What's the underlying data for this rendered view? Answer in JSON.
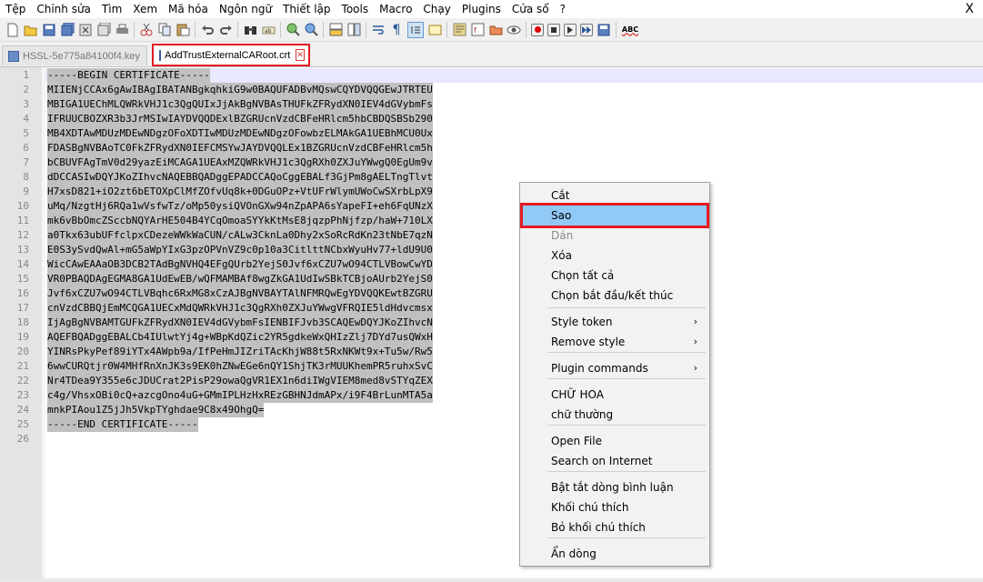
{
  "menubar": {
    "items": [
      "Tệp",
      "Chỉnh sửa",
      "Tìm",
      "Xem",
      "Mã hóa",
      "Ngôn ngữ",
      "Thiết lập",
      "Tools",
      "Macro",
      "Chạy",
      "Plugins",
      "Cửa sổ",
      "?"
    ],
    "close": "X"
  },
  "toolbar": {
    "icons": [
      "new-file-icon",
      "open-file-icon",
      "save-icon",
      "save-all-icon",
      "close-icon",
      "close-all-icon",
      "print-icon",
      "cut-icon",
      "copy-icon",
      "paste-icon",
      "undo-icon",
      "redo-icon",
      "find-icon",
      "replace-icon",
      "zoom-in-icon",
      "zoom-out-icon",
      "sync-vertical-icon",
      "sync-horizontal-icon",
      "word-wrap-icon",
      "show-all-chars-icon",
      "indent-guide-icon",
      "user-language-icon",
      "doc-map-icon",
      "function-list-icon",
      "folder-workspace-icon",
      "monitoring-icon",
      "record-macro-icon",
      "stop-record-icon",
      "play-macro-icon",
      "play-multiple-icon",
      "save-macro-icon",
      "spell-check-icon"
    ],
    "spell_label": "ABC"
  },
  "tabs": [
    {
      "label": "HSSL-5e775a84100f4.key",
      "active": false
    },
    {
      "label": "AddTrustExternalCARoot.crt",
      "active": true
    }
  ],
  "editor": {
    "lines": [
      "-----BEGIN CERTIFICATE-----",
      "MIIENjCCAx6gAwIBAgIBATANBgkqhkiG9w0BAQUFADBvMQswCQYDVQQGEwJTRTEU",
      "MBIGA1UEChMLQWRkVHJ1c3QgQUIxJjAkBgNVBAsTHUFkZFRydXN0IEV4dGVybmFs",
      "IFRUUCBOZXR3b3JrMSIwIAYDVQQDExlBZGRUcnVzdCBFeHRlcm5hbCBDQSBSb290",
      "MB4XDTAwMDUzMDEwNDgzOFoXDTIwMDUzMDEwNDgzOFowbzELMAkGA1UEBhMCU0Ux",
      "FDASBgNVBAoTC0FkZFRydXN0IEFCMSYwJAYDVQQLEx1BZGRUcnVzdCBFeHRlcm5h",
      "bCBUVFAgTmV0d29yazEiMCAGA1UEAxMZQWRkVHJ1c3QgRXh0ZXJuYWwgQ0EgUm9v",
      "dDCCASIwDQYJKoZIhvcNAQEBBQADggEPADCCAQoCggEBALf3GjPm8gAELTngTlvt",
      "H7xsD821+iO2zt6bETOXpClMfZOfvUq8k+0DGuOPz+VtUFrWlymUWoCwSXrbLpX9",
      "uMq/NzgtHj6RQa1wVsfwTz/oMp50ysiQVOnGXw94nZpAPA6sYapeFI+eh6FqUNzX",
      "mk6vBbOmcZSccbNQYArHE504B4YCqOmoaSYYkKtMsE8jqzpPhNjfzp/haW+710LX",
      "a0Tkx63ubUFfclpxCDezeWWkWaCUN/cALw3CknLa0Dhy2xSoRcRdKn23tNbE7qzN",
      "E0S3ySvdQwAl+mG5aWpYIxG3pzOPVnVZ9c0p10a3CitlttNCbxWyuHv77+ldU9U0",
      "WicCAwEAAaOB3DCB2TAdBgNVHQ4EFgQUrb2YejS0Jvf6xCZU7wO94CTLVBowCwYD",
      "VR0PBAQDAgEGMA8GA1UdEwEB/wQFMAMBAf8wgZkGA1UdIwSBkTCBjoAUrb2YejS0",
      "Jvf6xCZU7wO94CTLVBqhc6RxMG8xCzAJBgNVBAYTAlNFMRQwEgYDVQQKEwtBZGRU",
      "cnVzdCBBQjEmMCQGA1UECxMdQWRkVHJ1c3QgRXh0ZXJuYWwgVFRQIE5ldHdvcmsx",
      "IjAgBgNVBAMTGUFkZFRydXN0IEV4dGVybmFsIENBIFJvb3SCAQEwDQYJKoZIhvcN",
      "AQEFBQADggEBALCb4IUlwtYj4g+WBpKdQZic2YR5gdkeWxQHIzZlj7DYd7usQWxH",
      "YINRsPkyPef89iYTx4AWpb9a/IfPeHmJIZriTAcKhjW88t5RxNKWt9x+Tu5w/Rw5",
      "6wwCURQtjr0W4MHfRnXnJK3s9EK0hZNwEGe6nQY1ShjTK3rMUUKhemPR5ruhxSvC",
      "Nr4TDea9Y355e6cJDUCrat2PisP29owaQgVR1EX1n6diIWgVIEM8med8vSTYqZEX",
      "c4g/VhsxOBi0cQ+azcgOno4uG+GMmIPLHzHxREzGBHNJdmAPx/i9F4BrLunMTA5a",
      "mnkPIAou1Z5jJh5VkpTYghdae9C8x49OhgQ=",
      "-----END CERTIFICATE-----",
      ""
    ]
  },
  "context_menu": {
    "items": [
      {
        "label": "Cắt",
        "state": "normal"
      },
      {
        "label": "Sao",
        "state": "highlighted"
      },
      {
        "label": "Dán",
        "state": "disabled"
      },
      {
        "label": "Xóa",
        "state": "normal"
      },
      {
        "label": "Chọn tất cả",
        "state": "normal"
      },
      {
        "label": "Chọn bắt đầu/kết thúc",
        "state": "normal"
      },
      {
        "label": "Style token",
        "state": "submenu"
      },
      {
        "label": "Remove style",
        "state": "submenu"
      },
      {
        "label": "Plugin commands",
        "state": "submenu"
      },
      {
        "label": "CHỮ HOA",
        "state": "normal"
      },
      {
        "label": "chữ thường",
        "state": "normal"
      },
      {
        "label": "Open File",
        "state": "normal"
      },
      {
        "label": "Search on Internet",
        "state": "normal"
      },
      {
        "label": "Bật tắt dòng bình luận",
        "state": "normal"
      },
      {
        "label": "Khối chú thích",
        "state": "normal"
      },
      {
        "label": "Bỏ khối chú thích",
        "state": "normal"
      },
      {
        "label": "Ẩn dòng",
        "state": "normal"
      }
    ],
    "submenu_arrow": "›"
  },
  "colors": {
    "highlight_border": "#e31c24",
    "selection": "#c0c0c0",
    "menu_highlight": "#91c9f7"
  }
}
